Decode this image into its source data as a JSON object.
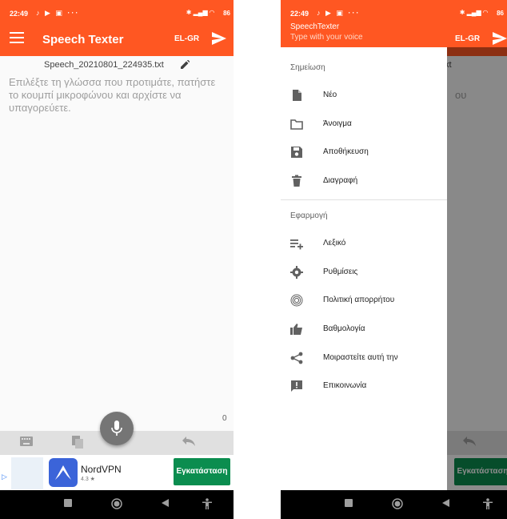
{
  "status": {
    "time": "22:49",
    "battery": "86"
  },
  "app": {
    "title": "Speech Texter",
    "language": "EL-GR"
  },
  "editor": {
    "filename": "Speech_20210801_224935.txt",
    "hint": "Επιλέξτε τη γλώσσα που προτιμάτε, πατήστε το κουμπί μικροφώνου και αρχίστε να υπαγορεύετε.",
    "char_count": "0"
  },
  "ad": {
    "name": "NordVPN",
    "rating": "4.3 ★",
    "button": "Εγκατάσταση"
  },
  "drawer": {
    "title": "SpeechTexter",
    "subtitle": "Type with your voice",
    "section_note": "Σημείωση",
    "section_app": "Εφαρμογή",
    "items": [
      {
        "label": "Νέο",
        "icon": "new-note-icon"
      },
      {
        "label": "Άνοιγμα",
        "icon": "folder-icon"
      },
      {
        "label": "Αποθήκευση",
        "icon": "save-icon"
      },
      {
        "label": "Διαγραφή",
        "icon": "delete-icon"
      },
      {
        "label": "Λεξικό",
        "icon": "playlist-add-icon"
      },
      {
        "label": "Ρυθμίσεις",
        "icon": "gear-icon"
      },
      {
        "label": "Πολιτική απορρήτου",
        "icon": "fingerprint-icon"
      },
      {
        "label": "Βαθμολογία",
        "icon": "thumb-up-icon"
      },
      {
        "label": "Μοιραστείτε αυτή την",
        "icon": "share-icon"
      },
      {
        "label": "Επικοινωνία",
        "icon": "feedback-icon"
      }
    ]
  },
  "behind": {
    "fragment_1": "xt",
    "fragment_2": "ου"
  }
}
